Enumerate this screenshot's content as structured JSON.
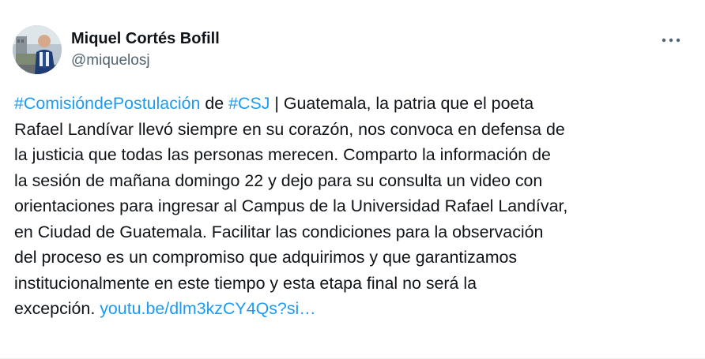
{
  "author": {
    "display_name": "Miquel Cortés Bofill",
    "handle": "@miquelosj",
    "avatar_icon": "profile-photo"
  },
  "more_icon": "more-dots-icon",
  "tweet": {
    "hashtag1": "#ComisióndePostulación",
    "text1": " de ",
    "hashtag2": "#CSJ",
    "text2": " | Guatemala, la patria que el poeta\nRafael Landívar llevó siempre en su corazón, nos convoca en defensa de\nla justicia que todas las personas merecen. Comparto la información de\nla sesión de mañana domingo 22 y dejo para su consulta un video con\norientaciones para ingresar al Campus de la Universidad Rafael Landívar,\nen Ciudad de Guatemala. Facilitar las condiciones para la observación\ndel proceso es un compromiso que adquirimos y que garantizamos\ninstitucionalmente en este tiempo y esta etapa final no será la\nexcepción. ",
    "link": "youtu.be/dlm3kzCY4Qs?si…"
  },
  "colors": {
    "link": "#1d9bf0",
    "text": "#0f1419",
    "secondary": "#536471"
  }
}
